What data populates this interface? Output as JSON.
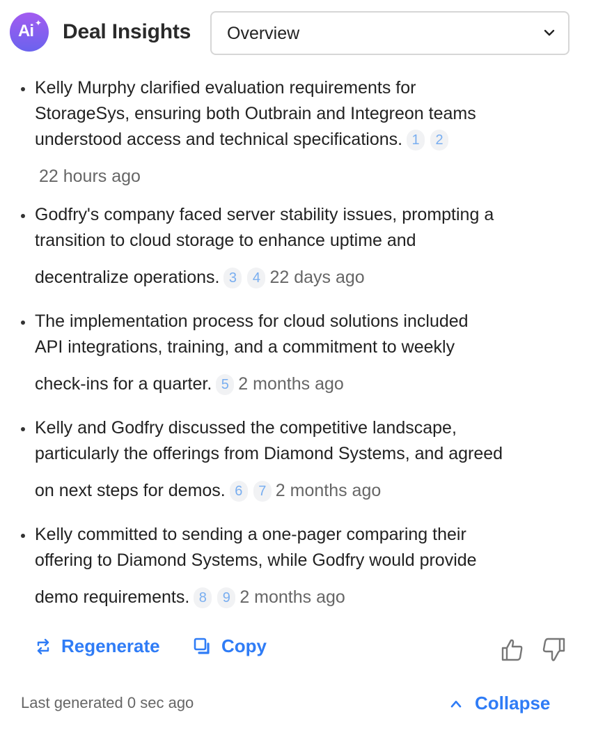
{
  "header": {
    "logo_text": "Ai",
    "title": "Deal Insights",
    "view_select": {
      "selected": "Overview"
    }
  },
  "insights": [
    {
      "lines": [
        "Kelly Murphy clarified evaluation requirements for",
        "StorageSys, ensuring both Outbrain and Integreon teams",
        "understood access and technical specifications."
      ],
      "citations": [
        "1",
        "2"
      ],
      "time": "22 hours ago"
    },
    {
      "lines": [
        "Godfry's company faced server stability issues, prompting a",
        "transition to cloud storage to enhance uptime and",
        "decentralize operations."
      ],
      "citations": [
        "3",
        "4"
      ],
      "time": "22 days ago"
    },
    {
      "lines": [
        "The implementation process for cloud solutions included",
        "API integrations, training, and a commitment to weekly",
        "check-ins for a quarter."
      ],
      "citations": [
        "5"
      ],
      "time": "2 months ago"
    },
    {
      "lines": [
        "Kelly and Godfry discussed the competitive landscape,",
        "particularly the offerings from Diamond Systems, and agreed",
        "on next steps for demos."
      ],
      "citations": [
        "6",
        "7"
      ],
      "time": "2 months ago"
    },
    {
      "lines": [
        "Kelly committed to sending a one-pager comparing their",
        "offering to Diamond Systems, while Godfry would provide",
        "demo requirements."
      ],
      "citations": [
        "8",
        "9"
      ],
      "time": "2 months ago"
    }
  ],
  "actions": {
    "regenerate_label": "Regenerate",
    "copy_label": "Copy",
    "icons": [
      "regenerate-icon",
      "copy-icon",
      "thumbs-up-icon",
      "thumbs-down-icon"
    ]
  },
  "footer": {
    "last_generated": "Last generated 0 sec ago",
    "collapse_label": "Collapse"
  },
  "colors": {
    "accent": "#2f7cf6",
    "logo_gradient_top": "#a35bf0",
    "logo_gradient_bottom": "#6b63ee",
    "citation_text": "#79aef0",
    "muted_text": "#666666"
  }
}
